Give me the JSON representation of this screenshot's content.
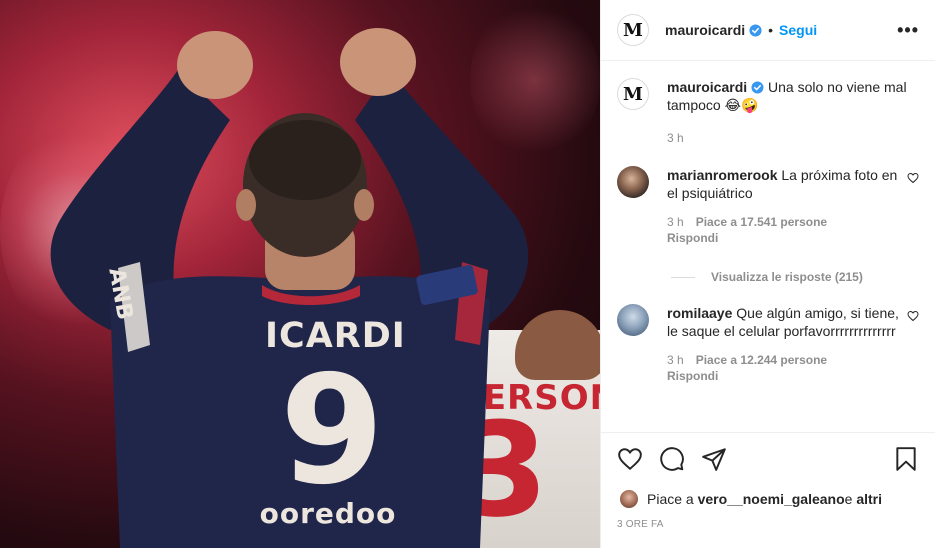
{
  "post": {
    "author": "mauroicardi",
    "follow_label": "Segui",
    "dot": "•",
    "more_label": "•••",
    "logo_text": "M",
    "photo": {
      "back_name": "ICARDI",
      "back_number": "9",
      "sponsor": "ooredoo",
      "sleeve_text": "ANB",
      "bg_name": "MERSON",
      "bg_number": "3"
    },
    "caption": {
      "username": "mauroicardi",
      "text": "Una solo no viene mal tampoco 😂🤪",
      "time": "3 h"
    },
    "comments": [
      {
        "username": "marianromerook",
        "text": "La próxima foto en el psiquiátrico",
        "time": "3 h",
        "likes": "Piace a 17.541 persone",
        "reply": "Rispondi"
      },
      {
        "username": "romilaaye",
        "text": "Que algún amigo, si tiene, le saque el celular porfavorrrrrrrrrrrrrr",
        "time": "3 h",
        "likes": "Piace a 12.244 persone",
        "reply": "Rispondi"
      }
    ],
    "view_replies": "Visualizza le risposte (215)",
    "liked_by": {
      "prefix": "Piace a ",
      "user": "vero__noemi_galeano",
      "middle": " e ",
      "others": "altri"
    },
    "timestamp": "3 ORE FA"
  },
  "icons": [
    "verified-badge-icon",
    "more-options-icon",
    "heart-icon",
    "comment-icon",
    "share-icon",
    "bookmark-icon"
  ],
  "colors": {
    "link": "#0095f6",
    "muted": "#8e8e8e",
    "text": "#262626",
    "verified": "#3897f0"
  }
}
